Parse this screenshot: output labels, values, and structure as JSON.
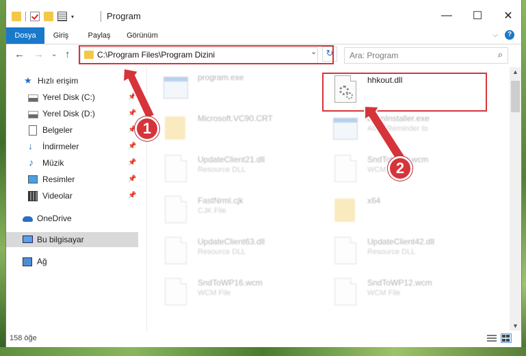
{
  "window": {
    "title": "Program"
  },
  "titlebar": {
    "minimize": "—",
    "maximize": "☐",
    "close": "✕"
  },
  "ribbon": {
    "tabs": [
      "Dosya",
      "Giriş",
      "Paylaş",
      "Görünüm"
    ],
    "expand_glyph": "⌵",
    "help_glyph": "?"
  },
  "nav": {
    "back_glyph": "←",
    "forward_glyph": "→",
    "recent_glyph": "⌄",
    "up_glyph": "↑",
    "address": "C:\\Program Files\\Program Dizini",
    "address_dropdown_glyph": "⌄",
    "refresh_glyph": "↻",
    "search_placeholder": "Ara: Program",
    "search_glyph": "⌕"
  },
  "sidebar": {
    "items": [
      {
        "label": "Hızlı erişim",
        "icon": "star-icon"
      },
      {
        "label": "Yerel Disk (C:)",
        "icon": "drive-icon",
        "pinned": true
      },
      {
        "label": "Yerel Disk (D:)",
        "icon": "drive-icon",
        "pinned": true
      },
      {
        "label": "Belgeler",
        "icon": "document-icon",
        "pinned": true
      },
      {
        "label": "İndirmeler",
        "icon": "download-icon",
        "pinned": true
      },
      {
        "label": "Müzik",
        "icon": "music-icon",
        "pinned": true
      },
      {
        "label": "Resimler",
        "icon": "pictures-icon",
        "pinned": true
      },
      {
        "label": "Videolar",
        "icon": "video-icon",
        "pinned": true
      },
      {
        "label": "OneDrive",
        "icon": "cloud-icon"
      },
      {
        "label": "Bu bilgisayar",
        "icon": "computer-icon",
        "selected": true
      },
      {
        "label": "Ağ",
        "icon": "network-icon"
      }
    ],
    "pin_glyph": "📌"
  },
  "files": [
    {
      "name": "program.exe",
      "desc": ""
    },
    {
      "name": "hhkout.dll",
      "desc": ""
    },
    {
      "name": "Microsoft.VC90.CRT",
      "desc": ""
    },
    {
      "name": "ammInstaller.exe",
      "desc": "AMM Reminder to"
    },
    {
      "name": "UpdateClient21.dll",
      "desc": "Resource DLL"
    },
    {
      "name": "SndToWcm.wcm",
      "desc": "WCM File"
    },
    {
      "name": "FastNrml.cjk",
      "desc": "CJK File"
    },
    {
      "name": "x64",
      "desc": ""
    },
    {
      "name": "UpdateClient63.dll",
      "desc": "Resource DLL"
    },
    {
      "name": "UpdateClient42.dll",
      "desc": "Resource DLL"
    },
    {
      "name": "SndToWP16.wcm",
      "desc": "WCM File"
    },
    {
      "name": "SndToWP12.wcm",
      "desc": "WCM File"
    }
  ],
  "status": {
    "count": "158 öğe"
  },
  "callouts": [
    "1",
    "2"
  ],
  "colors": {
    "accent": "#1979ca",
    "highlight": "#d6343a",
    "selection": "#d9d9d9"
  }
}
